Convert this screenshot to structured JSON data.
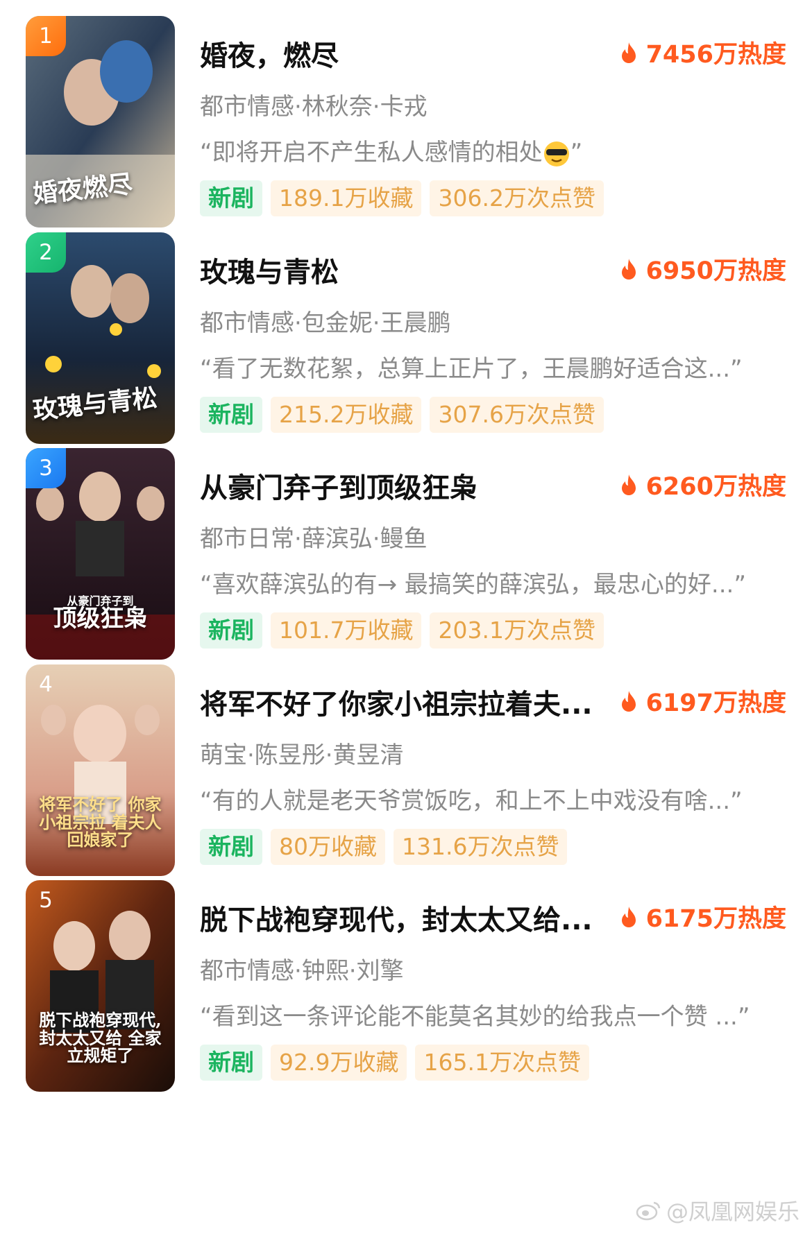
{
  "items": [
    {
      "rank": "1",
      "title": "婚夜，燃尽",
      "heat": "7456万热度",
      "tags": "都市情感·林秋奈·卡戎",
      "quote": "“即将开启不产生私人感情的相处",
      "quote_end": "”",
      "quote_emoji": "sunglasses-emoji",
      "badge_new": "新剧",
      "collections": "189.1万收藏",
      "likes": "306.2万次点赞",
      "poster_text": "婚夜燃尽"
    },
    {
      "rank": "2",
      "title": "玫瑰与青松",
      "heat": "6950万热度",
      "tags": "都市情感·包金妮·王晨鹏",
      "quote": "“看了无数花絮，总算上正片了，王晨鹏好适合这...”",
      "badge_new": "新剧",
      "collections": "215.2万收藏",
      "likes": "307.6万次点赞",
      "poster_text": "玫瑰与青松"
    },
    {
      "rank": "3",
      "title": "从豪门弃子到顶级狂枭",
      "heat": "6260万热度",
      "tags": "都市日常·薛滨弘·鳗鱼",
      "quote": "“喜欢薛滨弘的有→ 最搞笑的薛滨弘，最忠心的好...”",
      "badge_new": "新剧",
      "collections": "101.7万收藏",
      "likes": "203.1万次点赞",
      "poster_text": "顶级狂枭",
      "poster_sub": "从豪门弃子到"
    },
    {
      "rank": "4",
      "title": "将军不好了你家小祖宗拉着夫...",
      "heat": "6197万热度",
      "tags": "萌宝·陈昱彤·黄昱清",
      "quote": "“有的人就是老天爷赏饭吃，和上不上中戏没有啥...”",
      "badge_new": "新剧",
      "collections": "80万收藏",
      "likes": "131.6万次点赞",
      "poster_text": "将军不好了 你家小祖宗拉 着夫人回娘家了"
    },
    {
      "rank": "5",
      "title": "脱下战袍穿现代，封太太又给...",
      "heat": "6175万热度",
      "tags": "都市情感·钟熙·刘擎",
      "quote": "“看到这一条评论能不能莫名其妙的给我点一个赞 ...”",
      "badge_new": "新剧",
      "collections": "92.9万收藏",
      "likes": "165.1万次点赞",
      "poster_text": "脱下战袍穿现代, 封太太又给 全家立规矩了"
    }
  ],
  "watermark": "@凤凰网娱乐",
  "colors": {
    "heat": "#ff5a1f",
    "new_badge": "#1bb45f",
    "stat_badge": "#e6a347"
  }
}
